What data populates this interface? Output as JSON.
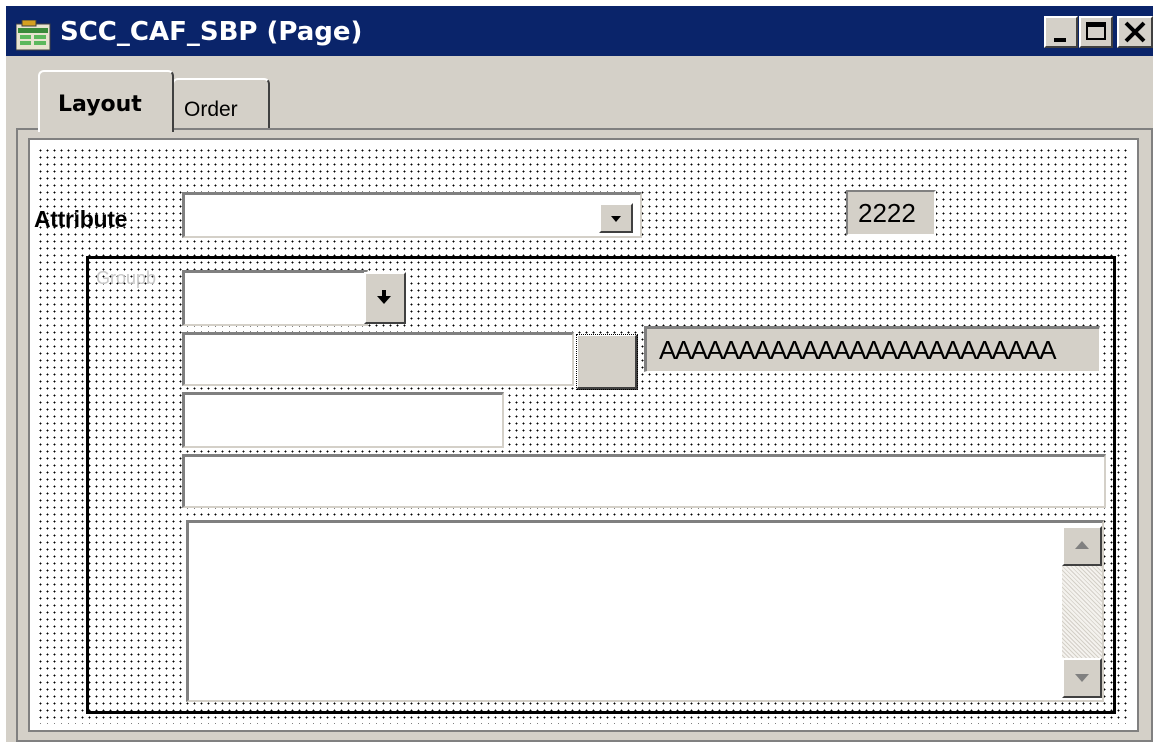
{
  "window": {
    "title": "SCC_CAF_SBP (Page)",
    "controls": {
      "minimize": "minimize-icon",
      "maximize": "maximize-icon",
      "close": "close-icon"
    }
  },
  "tabs": [
    {
      "label": "Layout",
      "active": true
    },
    {
      "label": "Order",
      "active": false
    }
  ],
  "page": {
    "attribute_label": "Attribute",
    "attribute_select_value": "",
    "number_field_value": "2222",
    "group_box_label": "Groupb",
    "short_dropdown_value": "",
    "edit_field_value": "",
    "display_field_value": "AAAAAAAAAAAAAAAAAAAAAAAAA",
    "short_edit_value": "",
    "wide_edit_value": "",
    "long_edit_value": ""
  },
  "colors": {
    "title_bar": "#0a246a",
    "window_face": "#d4d0c8",
    "group_label": "#c8c8c8"
  }
}
